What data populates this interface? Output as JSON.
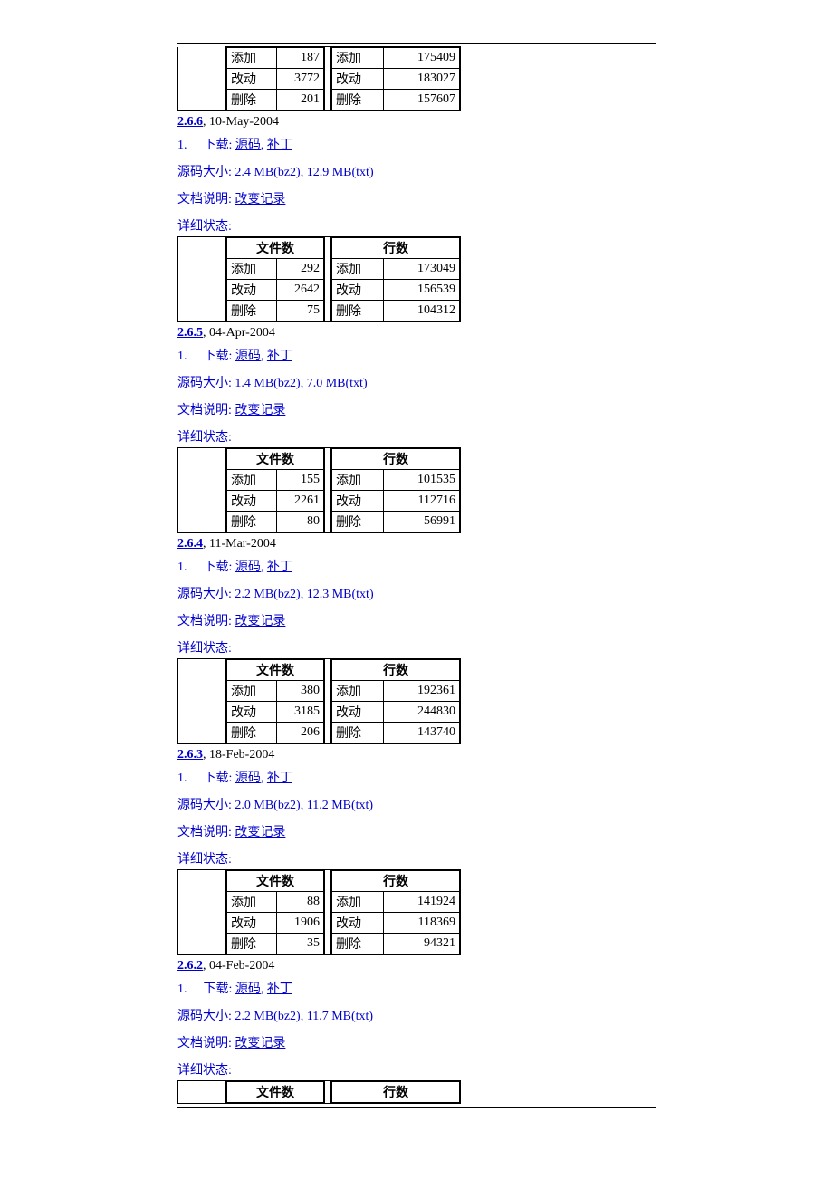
{
  "labels": {
    "files": "文件数",
    "lines": "行数",
    "add": "添加",
    "mod": "改动",
    "del": "删除",
    "download": "下载",
    "source": "源码",
    "patch": "补丁",
    "source_size": "源码大小",
    "doc_desc": "文档说明",
    "changelog": "改变记录",
    "detail_status": "详细状态"
  },
  "partial_top": {
    "files": {
      "add": "187",
      "mod": "3772",
      "del": "201"
    },
    "lines": {
      "add": "175409",
      "mod": "183027",
      "del": "157607"
    }
  },
  "releases": [
    {
      "version": "2.6.6",
      "date": "10-May-2004",
      "size": "2.4 MB(bz2), 12.9 MB(txt)",
      "files": {
        "add": "292",
        "mod": "2642",
        "del": "75"
      },
      "lines": {
        "add": "173049",
        "mod": "156539",
        "del": "104312"
      }
    },
    {
      "version": "2.6.5",
      "date": "04-Apr-2004",
      "size": "1.4 MB(bz2), 7.0 MB(txt)",
      "files": {
        "add": "155",
        "mod": "2261",
        "del": "80"
      },
      "lines": {
        "add": "101535",
        "mod": "112716",
        "del": "56991"
      }
    },
    {
      "version": "2.6.4",
      "date": "11-Mar-2004",
      "size": "2.2 MB(bz2), 12.3 MB(txt)",
      "files": {
        "add": "380",
        "mod": "3185",
        "del": "206"
      },
      "lines": {
        "add": "192361",
        "mod": "244830",
        "del": "143740"
      }
    },
    {
      "version": "2.6.3",
      "date": "18-Feb-2004",
      "size": "2.0 MB(bz2), 11.2 MB(txt)",
      "files": {
        "add": "88",
        "mod": "1906",
        "del": "35"
      },
      "lines": {
        "add": "141924",
        "mod": "118369",
        "del": "94321"
      }
    },
    {
      "version": "2.6.2",
      "date": "04-Feb-2004",
      "size": "2.2 MB(bz2), 11.7 MB(txt)"
    }
  ]
}
